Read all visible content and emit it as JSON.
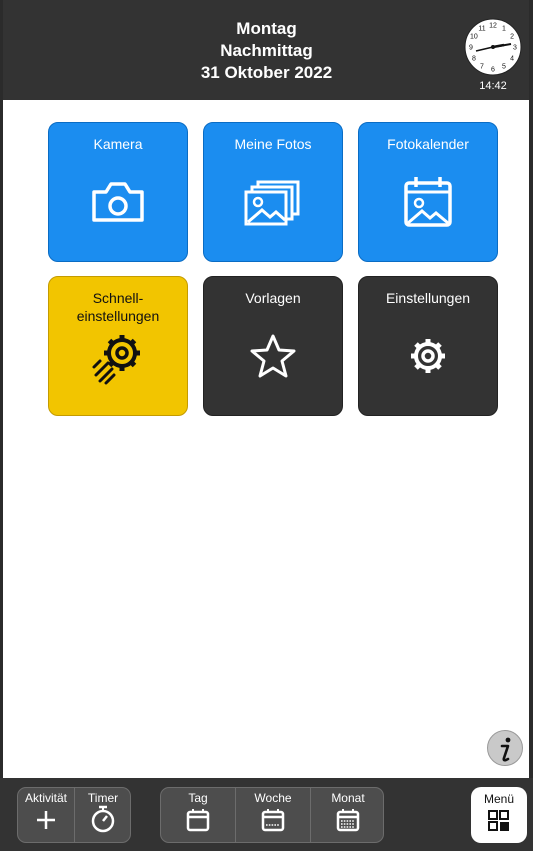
{
  "header": {
    "day": "Montag",
    "daypart": "Nachmittag",
    "date": "31 Oktober 2022",
    "time": "14:42"
  },
  "clock": {
    "numbers": [
      "12",
      "1",
      "2",
      "3",
      "4",
      "5",
      "6",
      "7",
      "8",
      "9",
      "10",
      "11"
    ]
  },
  "tiles": [
    {
      "label": "Kamera",
      "icon": "camera-icon",
      "color": "#1b8df0"
    },
    {
      "label": "Meine Fotos",
      "icon": "photos-icon",
      "color": "#1b8df0"
    },
    {
      "label": "Fotokalender",
      "icon": "photo-calendar-icon",
      "color": "#1b8df0"
    },
    {
      "label": "Schnell-\neinstellungen",
      "icon": "fast-gear-icon",
      "color": "#f2c500"
    },
    {
      "label": "Vorlagen",
      "icon": "star-icon",
      "color": "#333333"
    },
    {
      "label": "Einstellungen",
      "icon": "gear-icon",
      "color": "#333333"
    }
  ],
  "footer": {
    "activity": "Aktivität",
    "timer": "Timer",
    "day": "Tag",
    "week": "Woche",
    "month": "Monat",
    "menu": "Menü"
  }
}
